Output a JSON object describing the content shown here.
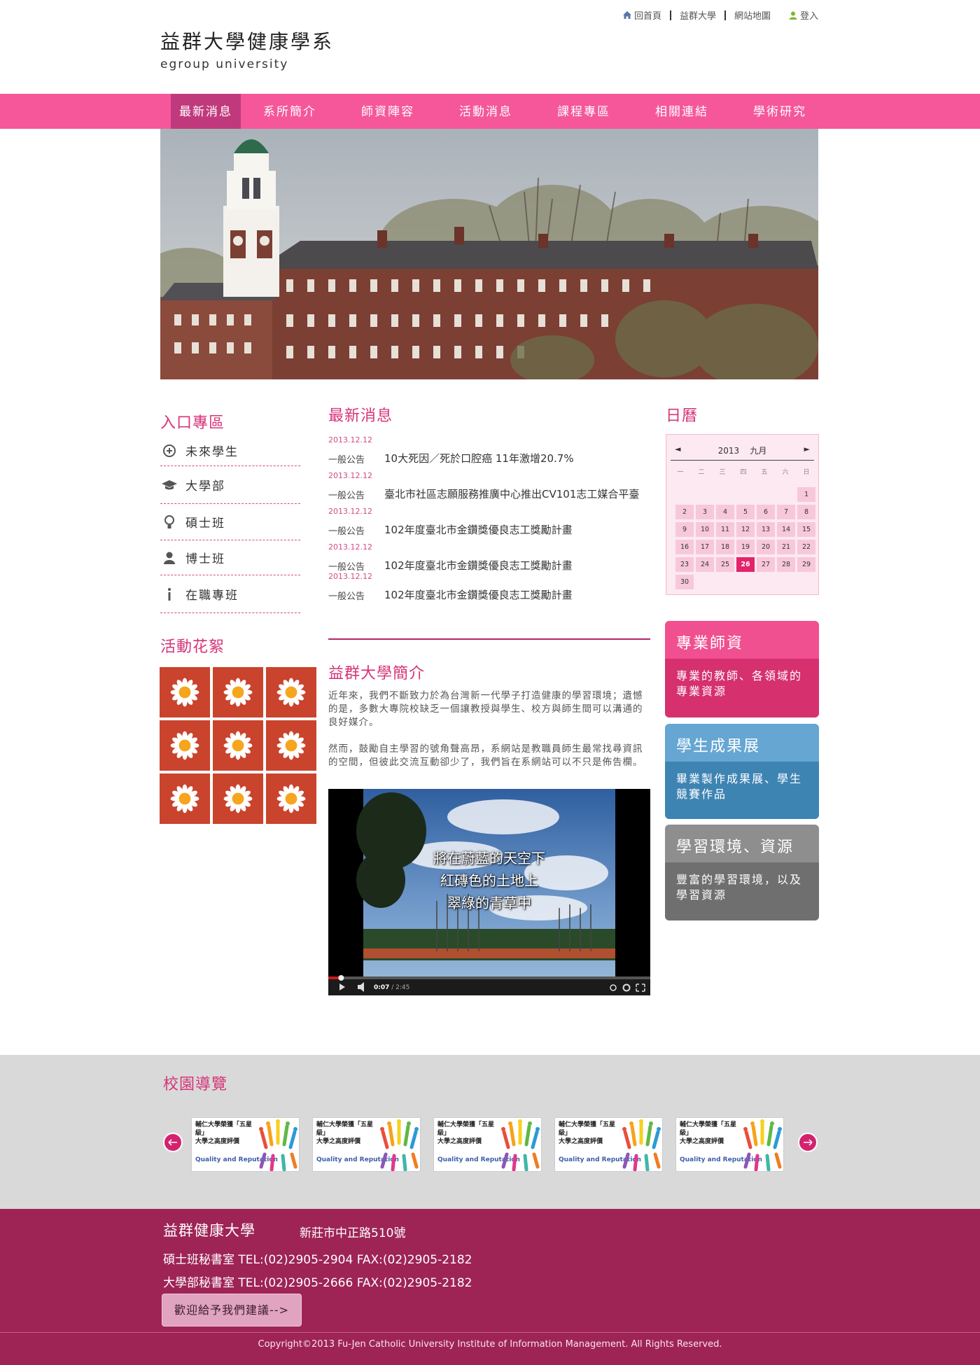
{
  "top_links": {
    "home": "回首頁",
    "university": "益群大學",
    "sitemap": "網站地圖",
    "login": "登入"
  },
  "logo": {
    "title": "益群大學健康學系",
    "subtitle": "egroup university"
  },
  "nav": {
    "items": [
      {
        "label": "最新消息",
        "active": true
      },
      {
        "label": "系所簡介"
      },
      {
        "label": "師資陣容"
      },
      {
        "label": "活動消息"
      },
      {
        "label": "課程專區"
      },
      {
        "label": "相關連結"
      },
      {
        "label": "學術研究"
      }
    ]
  },
  "entry": {
    "title": "入口專區",
    "items": [
      {
        "label": "未來學生",
        "icon": "compass-icon"
      },
      {
        "label": "大學部",
        "icon": "graduation-cap-icon"
      },
      {
        "label": "碩士班",
        "icon": "lightbulb-icon"
      },
      {
        "label": "博士班",
        "icon": "person-icon"
      },
      {
        "label": "在職專班",
        "icon": "info-icon"
      }
    ]
  },
  "gallery": {
    "title": "活動花絮"
  },
  "news": {
    "title": "最新消息",
    "items": [
      {
        "date": "2013.12.12",
        "category": "一般公告",
        "title": "10大死因／死於口腔癌 11年激增20.7%"
      },
      {
        "date": "2013.12.12",
        "category": "一般公告",
        "title": "臺北市社區志願服務推廣中心推出CV101志工媒合平臺"
      },
      {
        "date": "2013.12.12",
        "category": "一般公告",
        "title": "102年度臺北市金鑽獎優良志工獎勵計畫"
      },
      {
        "date": "2013.12.12",
        "category": "一般公告",
        "title": "102年度臺北市金鑽獎優良志工獎勵計畫"
      },
      {
        "date": "2013.12.12",
        "category": "一般公告",
        "title": "102年度臺北市金鑽獎優良志工獎勵計畫"
      }
    ]
  },
  "intro": {
    "title": "益群大學簡介",
    "para1": "近年來，我們不斷致力於為台灣新一代學子打造健康的學習環境；遺憾的是，多數大專院校缺乏一個讓教授與學生、校方與師生間可以溝通的良好媒介。",
    "para2": "然而，鼓勵自主學習的號角聲高昂，系網站是教職員師生最常找尋資訊的空間，但彼此交流互動卻少了，我們旨在系網站可以不只是佈告欄。"
  },
  "video": {
    "caption1": "將在蔚藍的天空下",
    "caption2": "紅磚色的土地上",
    "caption3": "翠綠的青草中",
    "time": "0:07",
    "duration": "/ 2:45",
    "progress": 0.04
  },
  "calendar": {
    "title": "日曆",
    "year": "2013",
    "month": "九月",
    "weekdays": [
      "一",
      "二",
      "三",
      "四",
      "五",
      "六",
      "日"
    ],
    "days": [
      "",
      "",
      "",
      "",
      "",
      "",
      "1",
      "2",
      "3",
      "4",
      "5",
      "6",
      "7",
      "8",
      "9",
      "10",
      "11",
      "12",
      "13",
      "14",
      "15",
      "16",
      "17",
      "18",
      "19",
      "20",
      "21",
      "22",
      "23",
      "24",
      "25",
      "26",
      "27",
      "28",
      "29",
      "30"
    ],
    "today": "26"
  },
  "side_boxes": [
    {
      "title": "專業師資",
      "text": "專業的教師、各領域的專業資源",
      "head_color": "#f04f90",
      "body_color": "#d6306f"
    },
    {
      "title": "學生成果展",
      "text": "畢業製作成果展、學生競賽作品",
      "head_color": "#66a6d3",
      "body_color": "#3e84b3"
    },
    {
      "title": "學習環境、資源",
      "text": "豐富的學習環境，以及學習資源",
      "head_color": "#8e8e8e",
      "body_color": "#6f6f6f"
    }
  ],
  "campus": {
    "title": "校園導覽",
    "thumb_line1": "輔仁大學榮獲「五星級」",
    "thumb_line2": "大學之高度評價",
    "thumb_line3": "Quality and Reputation",
    "thumb_count": 5
  },
  "footer": {
    "name": "益群健康大學",
    "address": "新莊市中正路510號",
    "line1": "碩士班秘書室 TEL:(02)2905-2904 FAX:(02)2905-2182",
    "line2": "大學部秘書室 TEL:(02)2905-2666 FAX:(02)2905-2182",
    "feedback_button": "歡迎給予我們建議-->",
    "copyright": "Copyright©2013 Fu-Jen Catholic University Institute of Information Management. All Rights Reserved."
  },
  "colors": {
    "accent": "#f5579a",
    "active_nav": "#c1397d",
    "title_pink": "#d63479",
    "footer": "#9e2456",
    "campus_bg": "#d9d9d9"
  }
}
